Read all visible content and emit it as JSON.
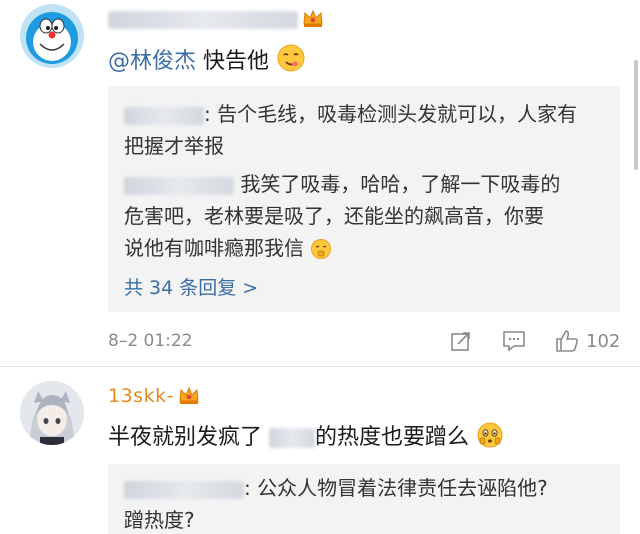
{
  "comment1": {
    "content_mention": "@林俊杰",
    "content_text": " 快告他",
    "emoji": "yummy-emoji",
    "replies": [
      {
        "text": ": 告个毛线，吸毒检测头发就可以，人家有",
        "text2": "把握才举报"
      },
      {
        "text": " 我笑了吸毒，哈哈，了解一下吸毒的",
        "text2": "危害吧，老林要是吸了，还能坐的飙高音，你要",
        "text3": "说他有咖啡瘾那我信"
      }
    ],
    "more_replies": "共 34 条回复 >",
    "time": "8–2 01:22",
    "like_count": "102"
  },
  "comment2": {
    "username": "13skk-",
    "content_text1": "半夜就别发疯了 ",
    "content_text2": "的热度也要蹭么",
    "replies": [
      {
        "text": ": 公众人物冒着法律责任去诬陷他?",
        "text2": "蹭热度?"
      }
    ]
  },
  "colors": {
    "username": "#e8891c",
    "link": "#3b6ea5",
    "reply_bg": "#f3f3f3",
    "meta": "#8a8a8a"
  }
}
